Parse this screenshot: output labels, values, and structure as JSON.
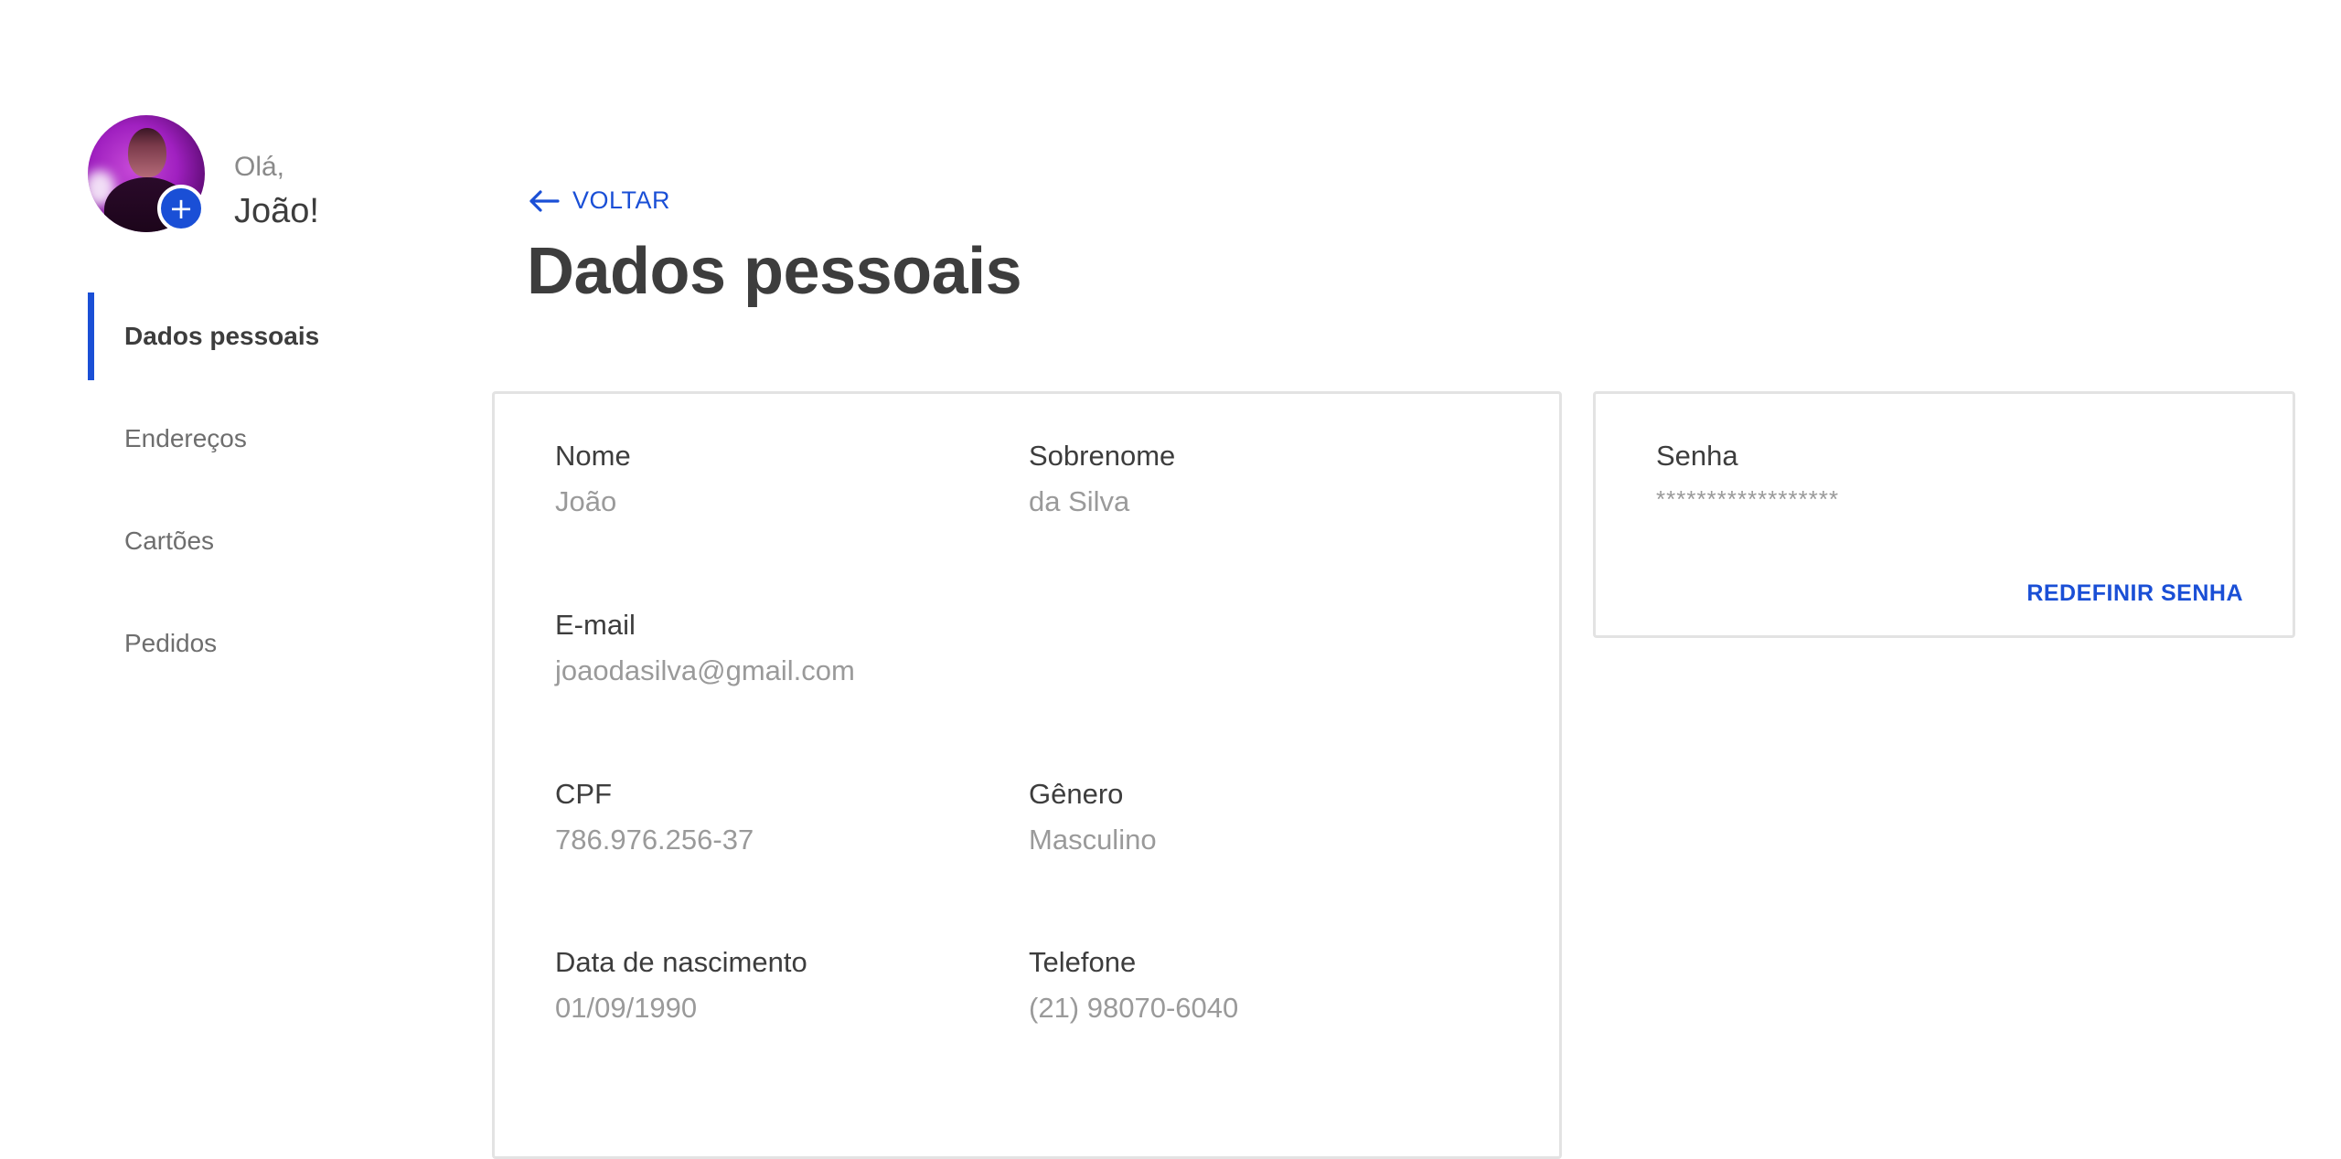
{
  "colors": {
    "accent": "#1a4fd6",
    "text_primary": "#3d3d3d",
    "text_secondary": "#9a9a9a",
    "border": "#e3e3e3"
  },
  "profile": {
    "greeting": "Olá,",
    "name": "João!",
    "add_photo_icon": "plus-icon"
  },
  "sidebar": {
    "items": [
      {
        "label": "Dados pessoais",
        "active": true
      },
      {
        "label": "Endereços",
        "active": false
      },
      {
        "label": "Cartões",
        "active": false
      },
      {
        "label": "Pedidos",
        "active": false
      }
    ]
  },
  "header": {
    "back_label": "VOLTAR",
    "back_icon": "arrow-left-icon",
    "title": "Dados pessoais"
  },
  "personal_data": {
    "first_name": {
      "label": "Nome",
      "value": "João"
    },
    "last_name": {
      "label": "Sobrenome",
      "value": "da Silva"
    },
    "email": {
      "label": "E-mail",
      "value": "joaodasilva@gmail.com"
    },
    "cpf": {
      "label": "CPF",
      "value": "786.976.256-37"
    },
    "gender": {
      "label": "Gênero",
      "value": "Masculino"
    },
    "birth_date": {
      "label": "Data de nascimento",
      "value": "01/09/1990"
    },
    "phone": {
      "label": "Telefone",
      "value": "(21) 98070-6040"
    }
  },
  "password": {
    "label": "Senha",
    "masked_value": "******************",
    "reset_label": "REDEFINIR SENHA"
  }
}
